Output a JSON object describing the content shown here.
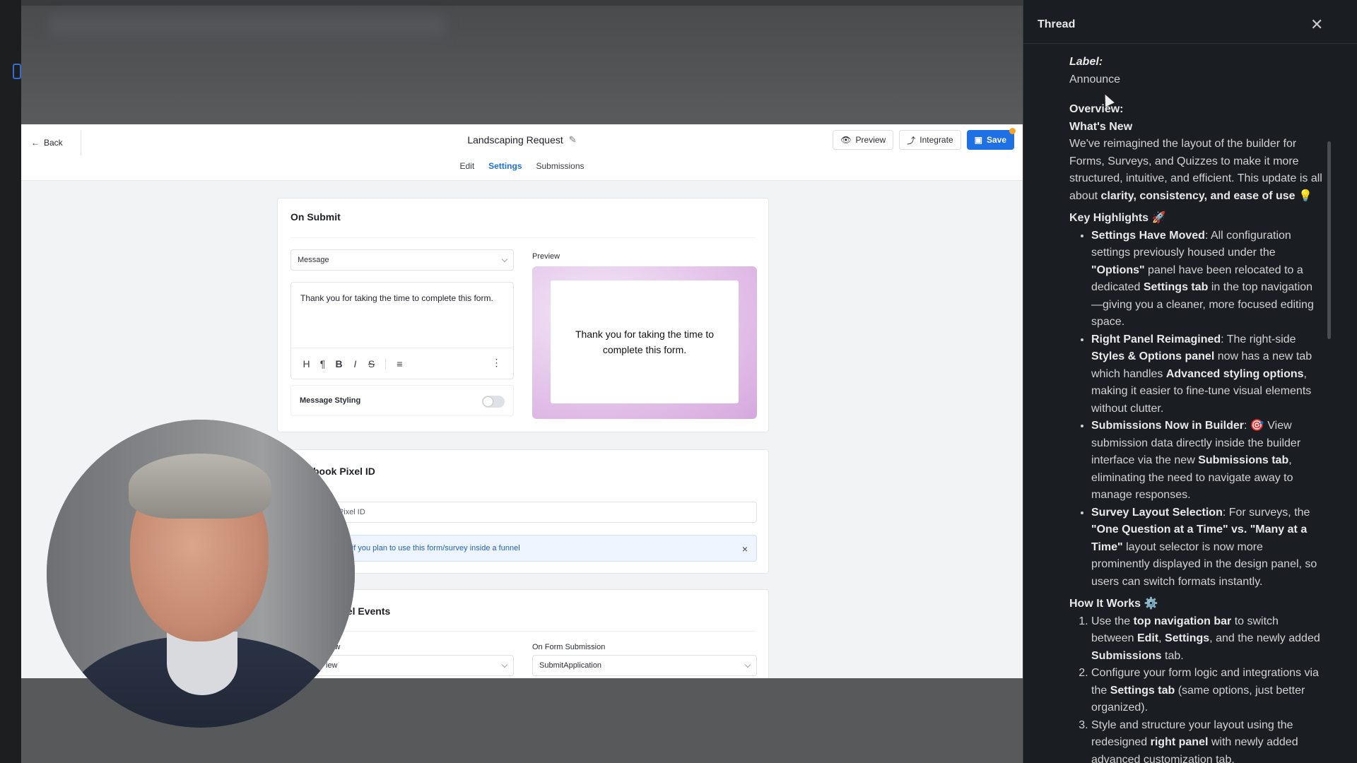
{
  "builder": {
    "back_label": "Back",
    "form_title": "Landscaping Request",
    "tabs": [
      {
        "label": "Edit"
      },
      {
        "label": "Settings"
      },
      {
        "label": "Submissions"
      }
    ],
    "buttons": {
      "preview": "Preview",
      "integrate": "Integrate",
      "save": "Save"
    },
    "on_submit": {
      "title": "On Submit",
      "select_value": "Message",
      "message_text": "Thank you for taking the time to complete this form.",
      "toolbar_tools": [
        "H",
        "¶",
        "B",
        "I",
        "S",
        "≡",
        "⋮"
      ],
      "message_styling_label": "Message Styling",
      "preview_label": "Preview",
      "preview_text": "Thank you for taking the time to complete this form."
    },
    "pixel_id": {
      "title": "book Pixel ID",
      "placeholder": "book Pixel ID",
      "info_text": "s field if you plan to use this form/survey inside a funnel",
      "info_close": "×"
    },
    "pixel_events": {
      "title": "xel Events",
      "left_label": "iew",
      "left_value": "iew",
      "right_label": "On Form Submission",
      "right_value": "SubmitApplication"
    }
  },
  "thread": {
    "title": "Thread",
    "close": "✕",
    "label_key": "Label",
    "label_value": "Announce",
    "overview_key": "Overview",
    "whats_new": "What's New",
    "intro_start": "We've reimagined the layout of the builder for Forms, Surveys, and Quizzes to make it more structured, intuitive, and efficient. This update is all about ",
    "intro_bold": "clarity, consistency, and ease of use",
    "intro_emoji": "💡",
    "key_highlights": "Key Highlights",
    "key_emoji": "🚀",
    "highlights": [
      {
        "title": "Settings Have Moved",
        "p1": ": All configuration settings previously housed under the ",
        "b1": "\"Options\"",
        "p2": " panel have been relocated to a dedicated ",
        "b2": "Settings tab",
        "p3": " in the top navigation—giving you a cleaner, more focused editing space."
      },
      {
        "title": "Right Panel Reimagined",
        "p1": ": The right-side ",
        "b1": "Styles & Options panel",
        "p2": " now has a new tab which handles ",
        "b2": "Advanced styling options",
        "p3": ", making it easier to fine-tune visual elements without clutter."
      },
      {
        "title": "Submissions Now in Builder",
        "p1": ": 🎯 View submission data directly inside the builder interface via the new ",
        "b1": "Submissions tab",
        "p2": ", eliminating the need to navigate away to manage responses.",
        "b2": "",
        "p3": ""
      },
      {
        "title": "Survey Layout Selection",
        "p1": ": For surveys, the ",
        "b1": "\"One Question at a Time\" vs. \"Many at a Time\"",
        "p2": " layout selector is now more prominently displayed in the design panel, so users can switch formats instantly.",
        "b2": "",
        "p3": ""
      }
    ],
    "how_it_works": "How It Works",
    "how_emoji": "⚙️",
    "steps": [
      {
        "p1": "Use the ",
        "b1": "top navigation bar",
        "p2": " to switch between ",
        "b2": "Edit",
        "p3": ", ",
        "b3": "Settings",
        "p4": ", and the newly added ",
        "b4": "Submissions",
        "p5": " tab."
      },
      {
        "p1": "Configure your form logic and integrations via the ",
        "b1": "Settings tab",
        "p2": " (same options, just better organized).",
        "b2": "",
        "p3": "",
        "b3": "",
        "p4": "",
        "b4": "",
        "p5": ""
      },
      {
        "p1": "Style and structure your layout using the redesigned ",
        "b1": "right panel",
        "p2": " with newly added advanced customization tab.",
        "b2": "",
        "p3": "",
        "b3": "",
        "p4": "",
        "b4": "",
        "p5": ""
      }
    ]
  }
}
